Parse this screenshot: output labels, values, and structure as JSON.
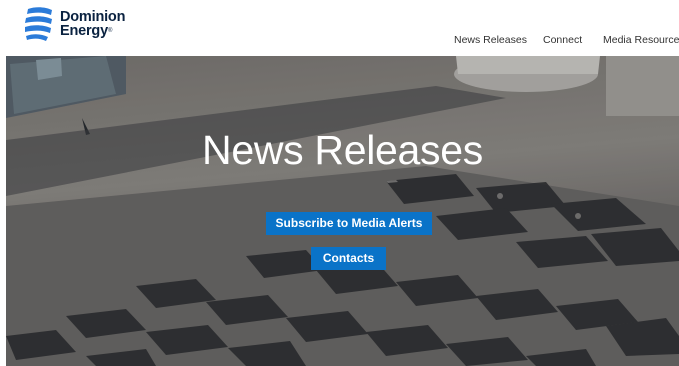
{
  "brand": {
    "line1": "Dominion",
    "line2": "Energy",
    "mark": "®",
    "color": "#0a2240",
    "accent": "#2b7bd9"
  },
  "nav": {
    "items": [
      "News Releases",
      "Connect",
      "Media Resources"
    ]
  },
  "hero": {
    "title": "News Releases",
    "subscribe_label": "Subscribe to Media Alerts",
    "contacts_label": "Contacts"
  },
  "colors": {
    "button": "#0a73c8"
  }
}
